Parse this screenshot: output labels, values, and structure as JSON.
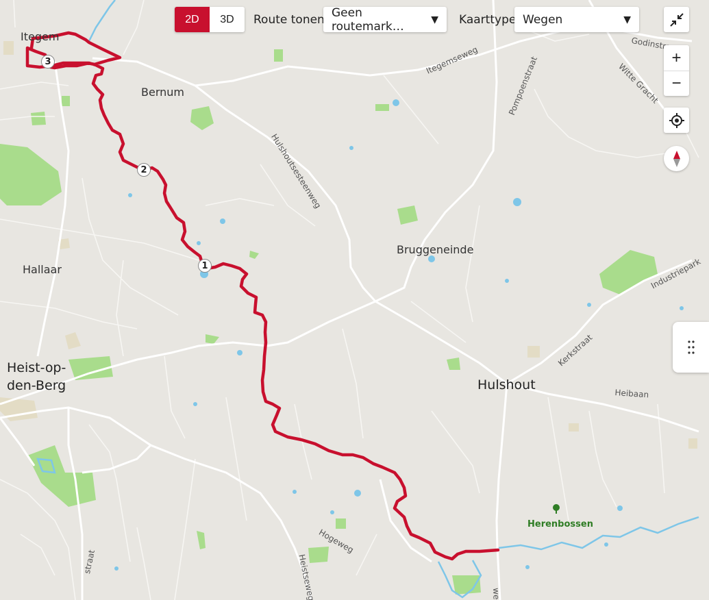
{
  "toolbar": {
    "mode_2d": "2D",
    "mode_3d": "3D",
    "active_mode": "2D",
    "route_label": "Route tonen",
    "route_select": "Geen routemark…",
    "maptype_label": "Kaarttype",
    "maptype_select": "Wegen"
  },
  "controls": {
    "zoom_in": "+",
    "zoom_out": "−"
  },
  "places": {
    "itegem": "Itegem",
    "bernum": "Bernum",
    "hallaar": "Hallaar",
    "heist_line1": "Heist-op-",
    "heist_line2": "den-Berg",
    "bruggeneinde": "Bruggeneinde",
    "hulshout": "Hulshout",
    "herenbossen": "Herenbossen"
  },
  "roads": {
    "itegemseweg": "Itegemseweg",
    "pompoenstraat": "Pompoenstraat",
    "godinstraat": "Godinstra",
    "witte_gracht": "Witte Gracht",
    "hulshoutsesteenweg": "Hulshoutsesteenweg",
    "industriepark": "Industriepark",
    "kerkstraat": "Kerkstraat",
    "heibaan": "Heibaan",
    "hogeweg": "Hogeweg",
    "heistseweg": "Heistseweg",
    "straat_sw": "straat",
    "weg_s": "weg"
  },
  "route_markers": [
    "1",
    "2",
    "3"
  ],
  "colors": {
    "route": "#c8102e",
    "accent": "#c8102e",
    "water": "#7ec6e8",
    "green": "#a9dc8c",
    "road": "#ffffff",
    "background": "#e8e6e1",
    "forest_label": "#2f7d25"
  },
  "icons": {
    "collapse": "collapse-arrows-icon",
    "locate": "crosshair-icon",
    "compass": "compass-icon",
    "handle": "drag-handle-icon",
    "forest": "tree-icon"
  }
}
